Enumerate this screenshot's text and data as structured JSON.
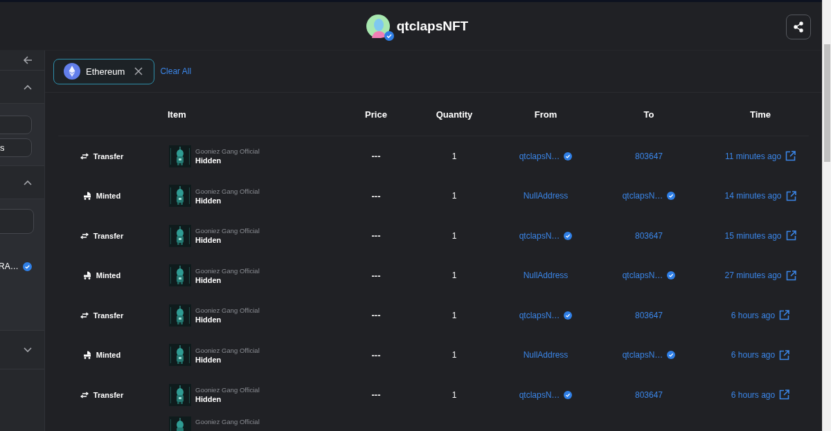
{
  "header": {
    "title": "qtclapsNFT",
    "verified": true
  },
  "sidebar": {
    "sections": [
      {
        "expanded": true,
        "fields": [
          {
            "kind": "empty"
          },
          {
            "kind": "text",
            "value": "s"
          }
        ]
      },
      {
        "expanded": true,
        "fields": [
          {
            "kind": "empty"
          }
        ],
        "items": [
          {
            "label": "RA…",
            "verified": true
          }
        ]
      },
      {
        "expanded": false
      }
    ]
  },
  "filters": [
    {
      "label": "Ethereum"
    }
  ],
  "clear_label": "Clear All",
  "table": {
    "columns": [
      "Item",
      "Price",
      "Quantity",
      "From",
      "To",
      "Time"
    ],
    "rows": [
      {
        "kind": "full",
        "event": {
          "kind": "transfer",
          "label": "Transfer"
        },
        "collection": "Gooniez Gang Official",
        "name": "Hidden",
        "price": "---",
        "quantity": "1",
        "from": {
          "label": "qtclapsN…",
          "verified": true
        },
        "to": {
          "label": "803647"
        },
        "time": "11 minutes ago"
      },
      {
        "kind": "full",
        "event": {
          "kind": "minted",
          "label": "Minted"
        },
        "collection": "Gooniez Gang Official",
        "name": "Hidden",
        "price": "---",
        "quantity": "1",
        "from": {
          "label": "NullAddress"
        },
        "to": {
          "label": "qtclapsN…",
          "verified": true
        },
        "time": "14 minutes ago"
      },
      {
        "kind": "full",
        "event": {
          "kind": "transfer",
          "label": "Transfer"
        },
        "collection": "Gooniez Gang Official",
        "name": "Hidden",
        "price": "---",
        "quantity": "1",
        "from": {
          "label": "qtclapsN…",
          "verified": true
        },
        "to": {
          "label": "803647"
        },
        "time": "15 minutes ago"
      },
      {
        "kind": "full",
        "event": {
          "kind": "minted",
          "label": "Minted"
        },
        "collection": "Gooniez Gang Official",
        "name": "Hidden",
        "price": "---",
        "quantity": "1",
        "from": {
          "label": "NullAddress"
        },
        "to": {
          "label": "qtclapsN…",
          "verified": true
        },
        "time": "27 minutes ago"
      },
      {
        "kind": "full",
        "event": {
          "kind": "transfer",
          "label": "Transfer"
        },
        "collection": "Gooniez Gang Official",
        "name": "Hidden",
        "price": "---",
        "quantity": "1",
        "from": {
          "label": "qtclapsN…",
          "verified": true
        },
        "to": {
          "label": "803647"
        },
        "time": "6 hours ago"
      },
      {
        "kind": "full",
        "event": {
          "kind": "minted",
          "label": "Minted"
        },
        "collection": "Gooniez Gang Official",
        "name": "Hidden",
        "price": "---",
        "quantity": "1",
        "from": {
          "label": "NullAddress"
        },
        "to": {
          "label": "qtclapsN…",
          "verified": true
        },
        "time": "6 hours ago"
      },
      {
        "kind": "full",
        "event": {
          "kind": "transfer",
          "label": "Transfer"
        },
        "collection": "Gooniez Gang Official",
        "name": "Hidden",
        "price": "---",
        "quantity": "1",
        "from": {
          "label": "qtclapsN…",
          "verified": true
        },
        "to": {
          "label": "803647"
        },
        "time": "6 hours ago"
      },
      {
        "kind": "partial",
        "collection": "Gooniez Gang Official"
      }
    ]
  }
}
